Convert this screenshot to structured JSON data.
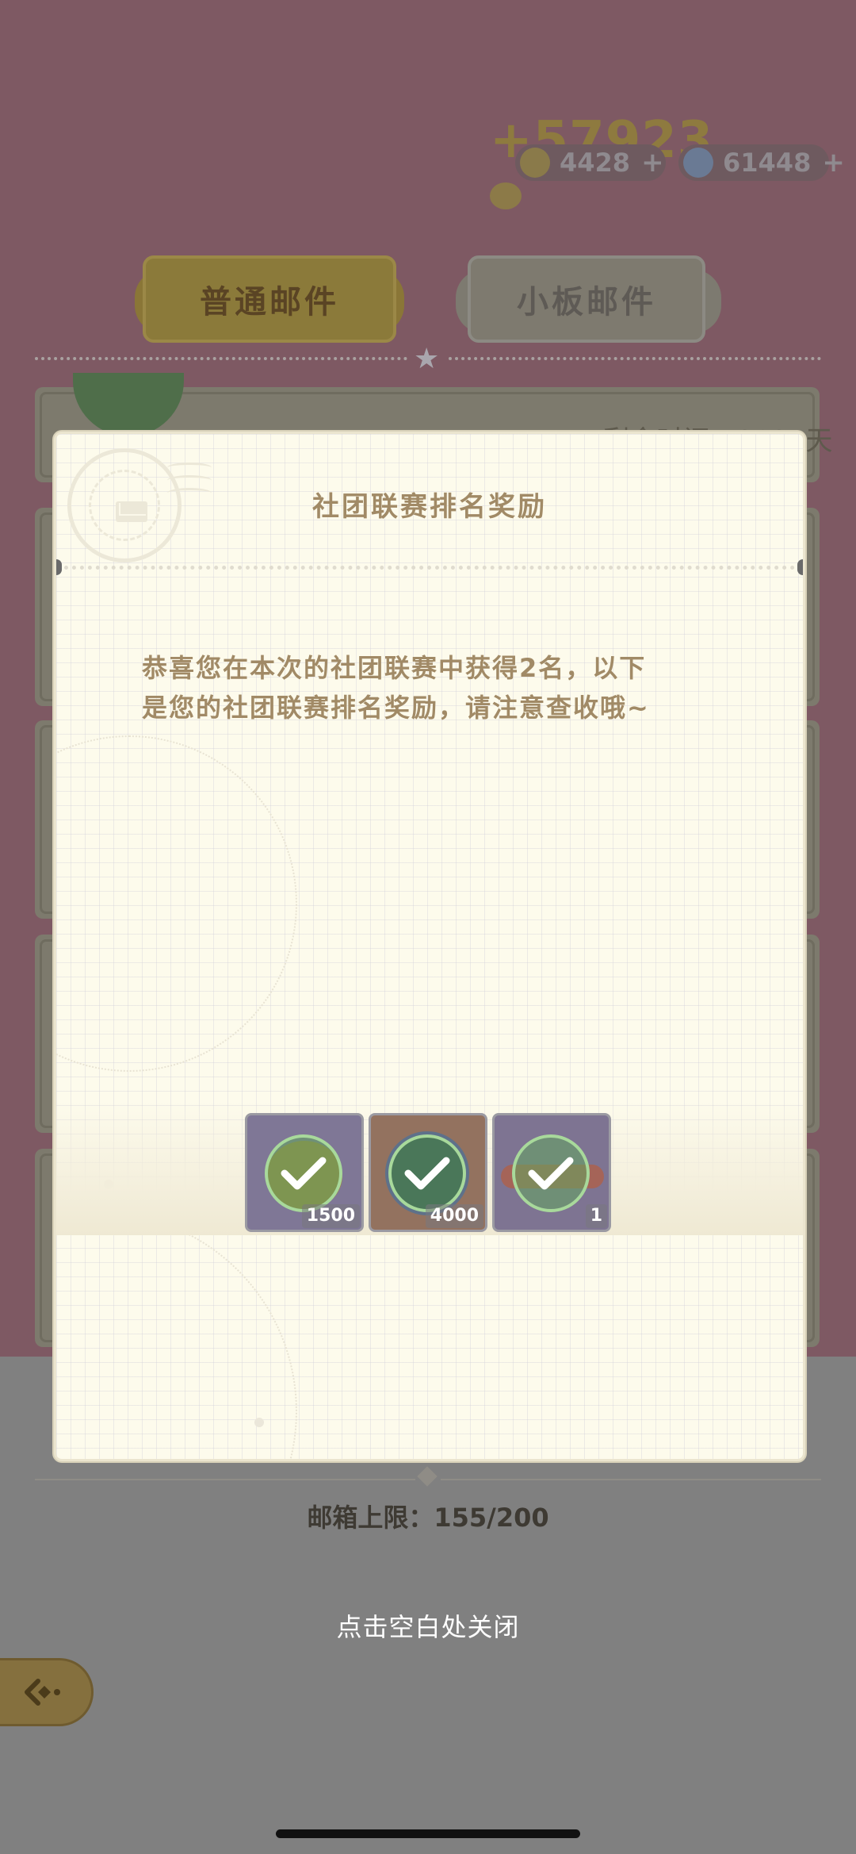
{
  "header": {
    "coin_gain": "+57923",
    "gold": {
      "value": "4428",
      "plus": "+"
    },
    "gems": {
      "value": "61448",
      "plus": "+"
    }
  },
  "tabs": [
    {
      "label": "普通邮件",
      "active": true
    },
    {
      "label": "小板邮件",
      "active": false
    }
  ],
  "background": {
    "mail_time": "剩余时间：2023天",
    "mailbox_limit": "邮箱上限：155/200"
  },
  "modal": {
    "title": "社团联赛排名奖励",
    "body": "恭喜您在本次的社团联赛中获得2名，以下\n是您的社团联赛排名奖励，请注意查收哦~",
    "rewards": [
      {
        "icon": "gold-coin-icon",
        "quantity": "1500",
        "claimed": true
      },
      {
        "icon": "diamond-icon",
        "quantity": "4000",
        "claimed": true
      },
      {
        "icon": "item-icon",
        "quantity": "1",
        "claimed": true
      }
    ]
  },
  "hint": "点击空白处关闭",
  "colors": {
    "modal_bg": "#fdfbec",
    "text_brown": "#a18a66",
    "check_green": "#62a65e"
  }
}
